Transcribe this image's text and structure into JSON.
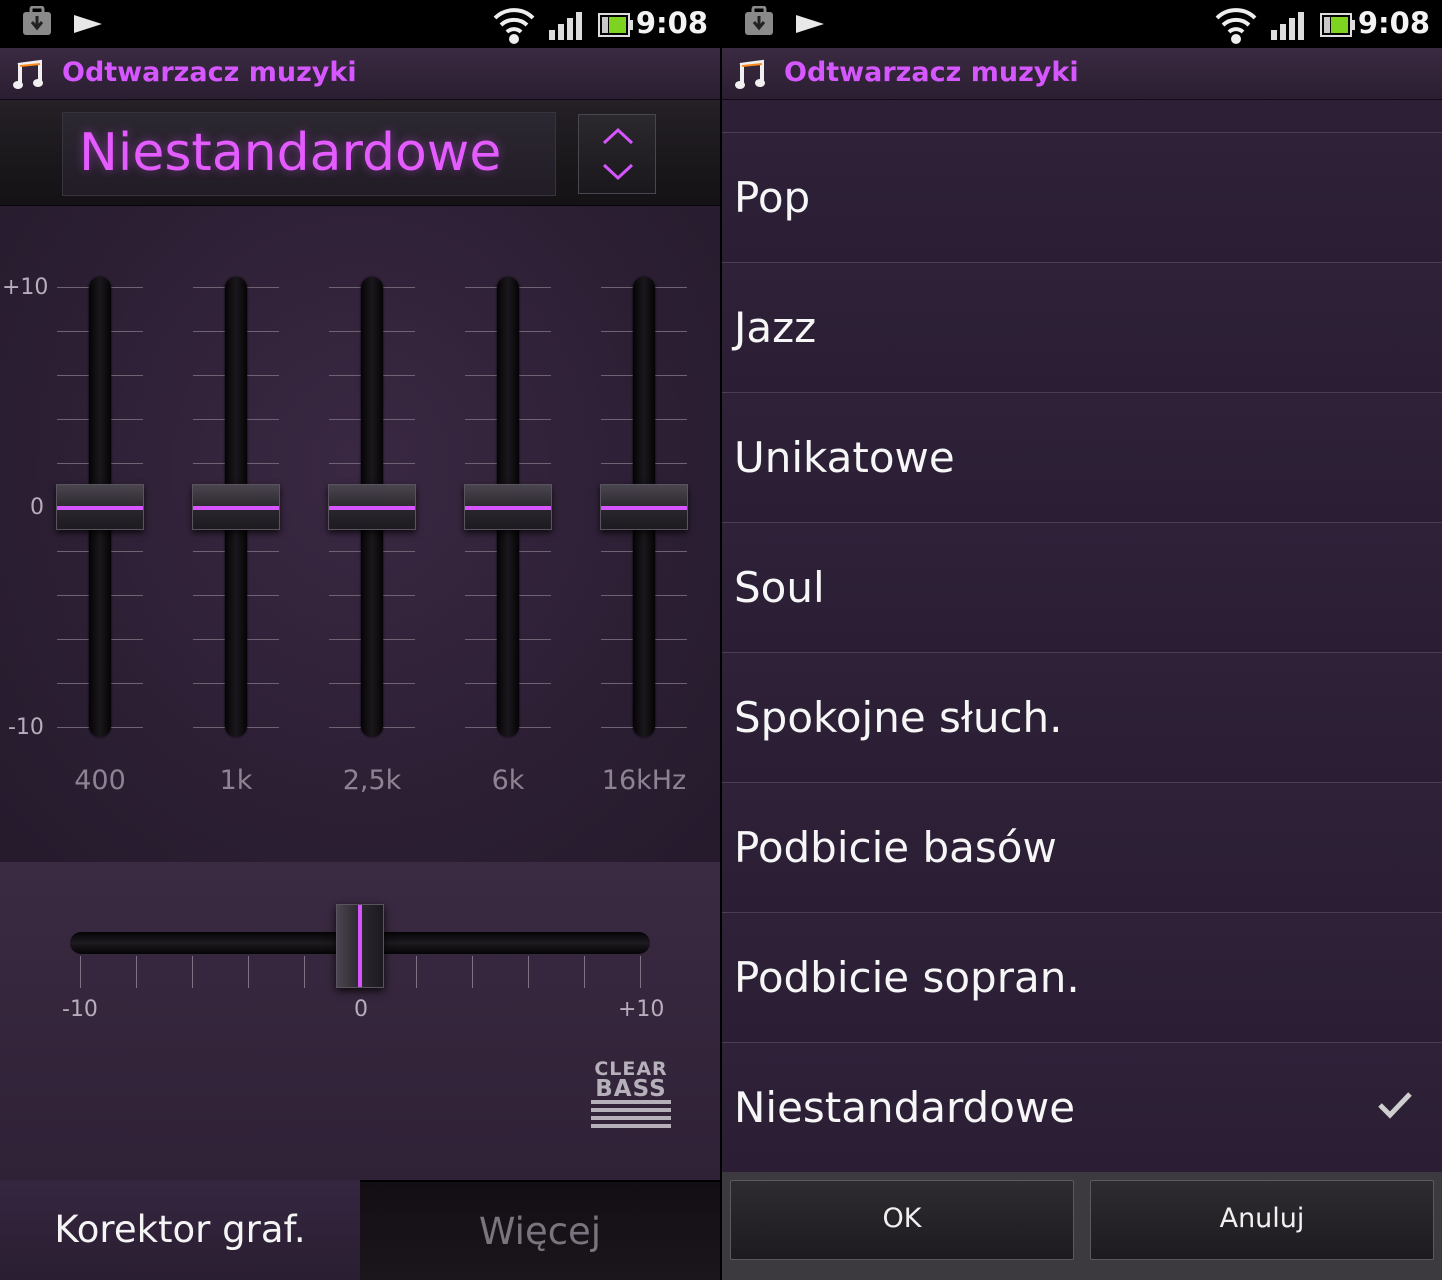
{
  "left": {
    "status": {
      "time": "9:08"
    },
    "app_title": "Odtwarzacz muzyki",
    "preset": "Niestandardowe",
    "eq": {
      "scale_top": "+10",
      "scale_mid": "0",
      "scale_bottom": "-10",
      "bands": [
        {
          "label": "400",
          "value": 0
        },
        {
          "label": "1k",
          "value": 0
        },
        {
          "label": "2,5k",
          "value": 0
        },
        {
          "label": "6k",
          "value": 0
        },
        {
          "label": "16kHz",
          "value": 0
        }
      ]
    },
    "clear_bass": {
      "min_label": "-10",
      "mid_label": "0",
      "max_label": "+10",
      "value": 0,
      "logo_top": "CLEAR",
      "logo_bottom": "BASS"
    },
    "tabs": [
      {
        "label": "Korektor graf.",
        "active": true
      },
      {
        "label": "Więcej",
        "active": false
      }
    ]
  },
  "right": {
    "status": {
      "time": "9:08"
    },
    "app_title": "Odtwarzacz muzyki",
    "presets": [
      {
        "label": "Pop",
        "selected": false
      },
      {
        "label": "Jazz",
        "selected": false
      },
      {
        "label": "Unikatowe",
        "selected": false
      },
      {
        "label": "Soul",
        "selected": false
      },
      {
        "label": "Spokojne słuch.",
        "selected": false
      },
      {
        "label": "Podbicie basów",
        "selected": false
      },
      {
        "label": "Podbicie sopran.",
        "selected": false
      },
      {
        "label": "Niestandardowe",
        "selected": true
      }
    ],
    "ok_label": "OK",
    "cancel_label": "Anuluj"
  },
  "colors": {
    "accent": "#d655ff",
    "background": "#2c1f36"
  },
  "icons": [
    "download-icon",
    "play-icon",
    "wifi-icon",
    "signal-icon",
    "battery-icon",
    "music-note-icon",
    "chevron-up-icon",
    "chevron-down-icon",
    "check-icon"
  ]
}
